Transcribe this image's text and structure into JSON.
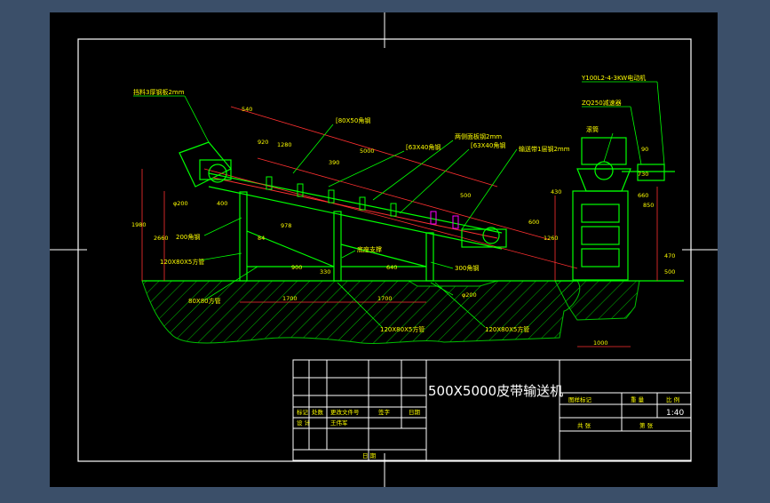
{
  "colors": {
    "background": "#3b4f69",
    "sheet": "#000000",
    "frame": "#ffffff",
    "drawing": "#00ff00",
    "dims": "#ff3030",
    "text": "#ffff00",
    "cyan": "#00ffff",
    "hatch": "#00c000",
    "highlight": "#ff00ff"
  },
  "drawing": {
    "title": "500X5000皮带输送机",
    "scale": "1:40",
    "labels": {
      "hopper_plate": "挡料3厚钢板2mm",
      "channel_a": "[80X50角钢",
      "channel_b": "[63X40角钢",
      "frame_plate": "两侧面板钢2mm",
      "channel_c": "[63X40角钢",
      "conveyor_plate": "输送带1层钢2mm",
      "angle_200": "200角钢",
      "tube": "120X80X5方管",
      "mount_bar": "底座支撑",
      "angle_300": "300角钢",
      "base_tube": "80X80方管",
      "tube_b": "120X80X5方管",
      "tube_c": "120X80X5方管",
      "motor": "Y100L2-4-3KW电动机",
      "reducer": "ZQ250减速器",
      "drum": "滚筒"
    },
    "dims": {
      "d540": "540",
      "d5000": "5000",
      "d1700": "1700",
      "d1700b": "1700",
      "d1000": "1000",
      "d500": "500",
      "d900": "900",
      "d920": "920",
      "d640": "640",
      "d1980": "1980",
      "d2660": "2660",
      "d1260": "1260",
      "d430": "430",
      "d200a": "φ200",
      "d200b": "φ200",
      "d400": "400",
      "d600": "600",
      "d470": "470",
      "d500b": "500",
      "d978": "978",
      "d390": "390",
      "d1280": "1280",
      "d730": "730",
      "d660": "660",
      "d850": "850",
      "d90": "90",
      "d84": "84",
      "d330": "330"
    }
  },
  "title_block": {
    "row1": [
      "标记",
      "处数",
      "更改文件号",
      "签字",
      "日期"
    ],
    "designer": "设 计",
    "designer_name": "王伟军",
    "approve": "日 期",
    "stage": "图样标记",
    "weight": "重 量",
    "ratio": "比 例",
    "sheet": "共 张",
    "sheet_of": "第 张"
  }
}
